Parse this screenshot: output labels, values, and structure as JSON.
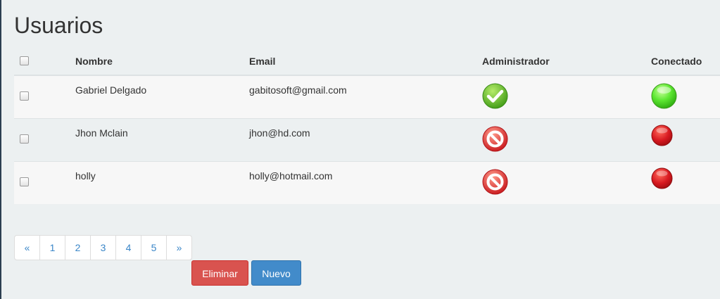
{
  "page": {
    "title": "Usuarios"
  },
  "table": {
    "headers": {
      "name": "Nombre",
      "email": "Email",
      "admin": "Administrador",
      "connected": "Conectado"
    },
    "rows": [
      {
        "name": "Gabriel Delgado",
        "email": "gabitosoft@gmail.com",
        "admin_icon": "green-check-icon",
        "connected_icon": "green-status-icon"
      },
      {
        "name": "Jhon Mclain",
        "email": "jhon@hd.com",
        "admin_icon": "red-forbidden-icon",
        "connected_icon": "red-status-icon"
      },
      {
        "name": "holly",
        "email": "holly@hotmail.com",
        "admin_icon": "red-forbidden-icon",
        "connected_icon": "red-status-icon"
      }
    ]
  },
  "pagination": {
    "prev": "«",
    "pages": [
      "1",
      "2",
      "3",
      "4",
      "5"
    ],
    "next": "»"
  },
  "actions": {
    "delete_label": "Eliminar",
    "new_label": "Nuevo"
  },
  "colors": {
    "danger": "#d9534f",
    "primary": "#428bca",
    "link": "#3a86c8",
    "background": "#ecf0f1"
  }
}
